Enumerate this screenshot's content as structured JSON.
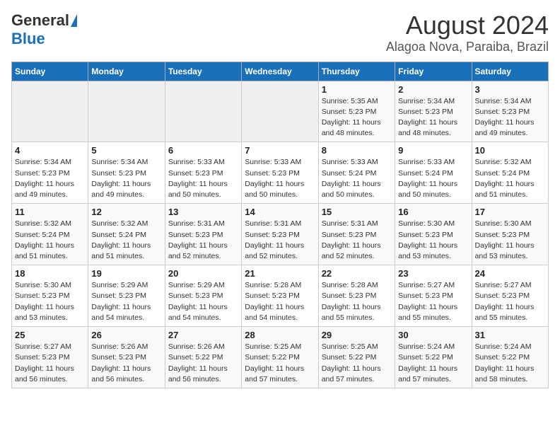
{
  "header": {
    "logo_line1": "General",
    "logo_line2": "Blue",
    "title": "August 2024",
    "subtitle": "Alagoa Nova, Paraiba, Brazil"
  },
  "weekdays": [
    "Sunday",
    "Monday",
    "Tuesday",
    "Wednesday",
    "Thursday",
    "Friday",
    "Saturday"
  ],
  "weeks": [
    [
      {
        "day": "",
        "info": ""
      },
      {
        "day": "",
        "info": ""
      },
      {
        "day": "",
        "info": ""
      },
      {
        "day": "",
        "info": ""
      },
      {
        "day": "1",
        "info": "Sunrise: 5:35 AM\nSunset: 5:23 PM\nDaylight: 11 hours\nand 48 minutes."
      },
      {
        "day": "2",
        "info": "Sunrise: 5:34 AM\nSunset: 5:23 PM\nDaylight: 11 hours\nand 48 minutes."
      },
      {
        "day": "3",
        "info": "Sunrise: 5:34 AM\nSunset: 5:23 PM\nDaylight: 11 hours\nand 49 minutes."
      }
    ],
    [
      {
        "day": "4",
        "info": "Sunrise: 5:34 AM\nSunset: 5:23 PM\nDaylight: 11 hours\nand 49 minutes."
      },
      {
        "day": "5",
        "info": "Sunrise: 5:34 AM\nSunset: 5:23 PM\nDaylight: 11 hours\nand 49 minutes."
      },
      {
        "day": "6",
        "info": "Sunrise: 5:33 AM\nSunset: 5:23 PM\nDaylight: 11 hours\nand 50 minutes."
      },
      {
        "day": "7",
        "info": "Sunrise: 5:33 AM\nSunset: 5:23 PM\nDaylight: 11 hours\nand 50 minutes."
      },
      {
        "day": "8",
        "info": "Sunrise: 5:33 AM\nSunset: 5:24 PM\nDaylight: 11 hours\nand 50 minutes."
      },
      {
        "day": "9",
        "info": "Sunrise: 5:33 AM\nSunset: 5:24 PM\nDaylight: 11 hours\nand 50 minutes."
      },
      {
        "day": "10",
        "info": "Sunrise: 5:32 AM\nSunset: 5:24 PM\nDaylight: 11 hours\nand 51 minutes."
      }
    ],
    [
      {
        "day": "11",
        "info": "Sunrise: 5:32 AM\nSunset: 5:24 PM\nDaylight: 11 hours\nand 51 minutes."
      },
      {
        "day": "12",
        "info": "Sunrise: 5:32 AM\nSunset: 5:24 PM\nDaylight: 11 hours\nand 51 minutes."
      },
      {
        "day": "13",
        "info": "Sunrise: 5:31 AM\nSunset: 5:23 PM\nDaylight: 11 hours\nand 52 minutes."
      },
      {
        "day": "14",
        "info": "Sunrise: 5:31 AM\nSunset: 5:23 PM\nDaylight: 11 hours\nand 52 minutes."
      },
      {
        "day": "15",
        "info": "Sunrise: 5:31 AM\nSunset: 5:23 PM\nDaylight: 11 hours\nand 52 minutes."
      },
      {
        "day": "16",
        "info": "Sunrise: 5:30 AM\nSunset: 5:23 PM\nDaylight: 11 hours\nand 53 minutes."
      },
      {
        "day": "17",
        "info": "Sunrise: 5:30 AM\nSunset: 5:23 PM\nDaylight: 11 hours\nand 53 minutes."
      }
    ],
    [
      {
        "day": "18",
        "info": "Sunrise: 5:30 AM\nSunset: 5:23 PM\nDaylight: 11 hours\nand 53 minutes."
      },
      {
        "day": "19",
        "info": "Sunrise: 5:29 AM\nSunset: 5:23 PM\nDaylight: 11 hours\nand 54 minutes."
      },
      {
        "day": "20",
        "info": "Sunrise: 5:29 AM\nSunset: 5:23 PM\nDaylight: 11 hours\nand 54 minutes."
      },
      {
        "day": "21",
        "info": "Sunrise: 5:28 AM\nSunset: 5:23 PM\nDaylight: 11 hours\nand 54 minutes."
      },
      {
        "day": "22",
        "info": "Sunrise: 5:28 AM\nSunset: 5:23 PM\nDaylight: 11 hours\nand 55 minutes."
      },
      {
        "day": "23",
        "info": "Sunrise: 5:27 AM\nSunset: 5:23 PM\nDaylight: 11 hours\nand 55 minutes."
      },
      {
        "day": "24",
        "info": "Sunrise: 5:27 AM\nSunset: 5:23 PM\nDaylight: 11 hours\nand 55 minutes."
      }
    ],
    [
      {
        "day": "25",
        "info": "Sunrise: 5:27 AM\nSunset: 5:23 PM\nDaylight: 11 hours\nand 56 minutes."
      },
      {
        "day": "26",
        "info": "Sunrise: 5:26 AM\nSunset: 5:23 PM\nDaylight: 11 hours\nand 56 minutes."
      },
      {
        "day": "27",
        "info": "Sunrise: 5:26 AM\nSunset: 5:22 PM\nDaylight: 11 hours\nand 56 minutes."
      },
      {
        "day": "28",
        "info": "Sunrise: 5:25 AM\nSunset: 5:22 PM\nDaylight: 11 hours\nand 57 minutes."
      },
      {
        "day": "29",
        "info": "Sunrise: 5:25 AM\nSunset: 5:22 PM\nDaylight: 11 hours\nand 57 minutes."
      },
      {
        "day": "30",
        "info": "Sunrise: 5:24 AM\nSunset: 5:22 PM\nDaylight: 11 hours\nand 57 minutes."
      },
      {
        "day": "31",
        "info": "Sunrise: 5:24 AM\nSunset: 5:22 PM\nDaylight: 11 hours\nand 58 minutes."
      }
    ]
  ]
}
